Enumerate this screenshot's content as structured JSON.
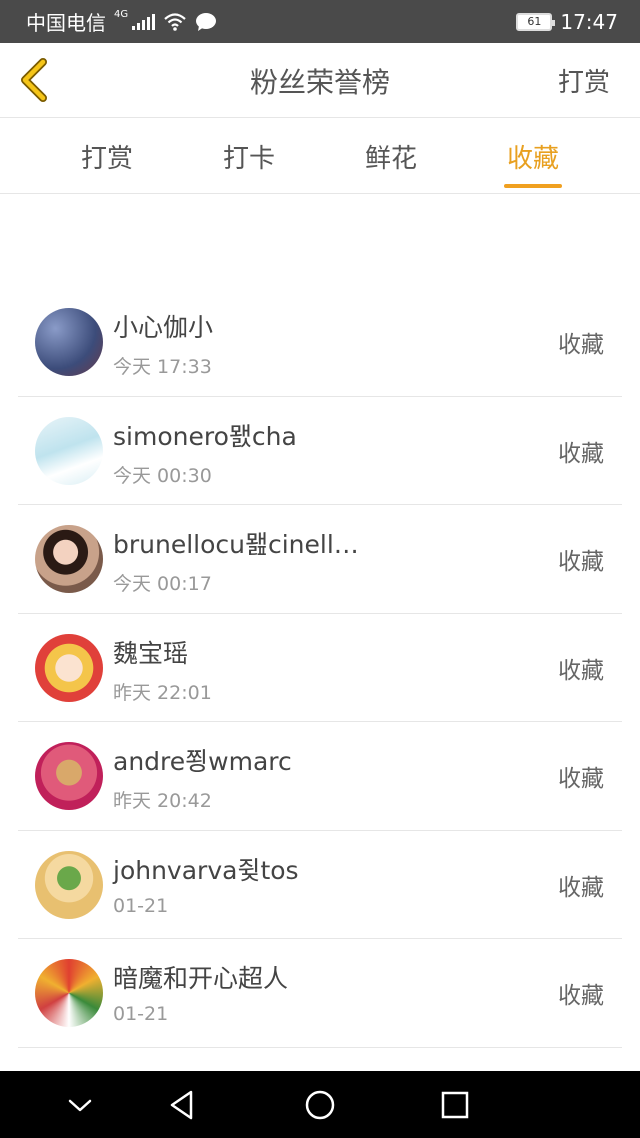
{
  "status_bar": {
    "carrier": "中国电信",
    "network": "4G",
    "battery": "61",
    "time": "17:47"
  },
  "header": {
    "title": "粉丝荣誉榜",
    "action": "打赏",
    "back_icon": "chevron-left-icon",
    "accent_color": "#f0a020"
  },
  "tabs": [
    {
      "label": "打赏",
      "active": false
    },
    {
      "label": "打卡",
      "active": false
    },
    {
      "label": "鲜花",
      "active": false
    },
    {
      "label": "收藏",
      "active": true
    }
  ],
  "list": [
    {
      "name": "小心伽小",
      "time": "今天 17:33",
      "action": "收藏"
    },
    {
      "name": "simonero뫬cha",
      "time": "今天 00:30",
      "action": "收藏"
    },
    {
      "name": "brunellocu뫮cinell…",
      "time": "今天 00:17",
      "action": "收藏"
    },
    {
      "name": "魏宝瑶",
      "time": "昨天 22:01",
      "action": "收藏"
    },
    {
      "name": "andre쬥wmarc",
      "time": "昨天 20:42",
      "action": "收藏"
    },
    {
      "name": "johnvarva쥦tos",
      "time": "01-21",
      "action": "收藏"
    },
    {
      "name": "暗魔和开心超人",
      "time": "01-21",
      "action": "收藏"
    }
  ],
  "nav": {
    "icons": [
      "chevron-down-icon",
      "back-triangle-icon",
      "home-circle-icon",
      "recents-square-icon"
    ]
  }
}
